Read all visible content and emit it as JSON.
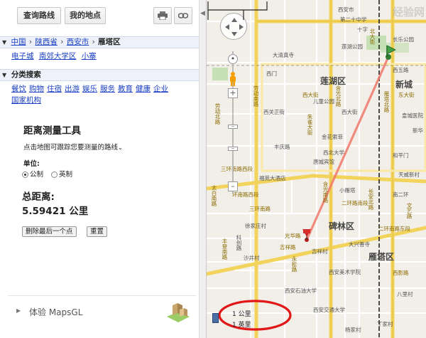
{
  "toolbar": {
    "directions_label": "查询路线",
    "myplaces_label": "我的地点",
    "print_icon": "print-icon",
    "link_icon": "link-icon"
  },
  "breadcrumb": {
    "items": [
      "中国",
      "陕西省",
      "西安市"
    ],
    "current": "雁塔区"
  },
  "sub_areas": [
    "电子城",
    "南郊大学区",
    "小寨"
  ],
  "category": {
    "title": "分类搜索",
    "items": [
      "餐饮",
      "购物",
      "住宿",
      "出游",
      "娱乐",
      "服务",
      "教育",
      "健康",
      "企业",
      "国家机构"
    ]
  },
  "measure_tool": {
    "title": "距离测量工具",
    "hint": "点击地图可跟踪您要测量的路线",
    "unit_label": "单位:",
    "unit_options": [
      "公制",
      "英制"
    ],
    "unit_selected": "公制",
    "total_label": "总距离:",
    "total_value": "5.59421 公里",
    "delete_label": "删除最后一个点",
    "reset_label": "重置"
  },
  "mapsgl": {
    "label": "体验 MapsGL"
  },
  "map": {
    "districts": [
      "莲湖区",
      "新城",
      "碑林区",
      "雁塔区"
    ],
    "place_labels": {
      "p1": "西安市",
      "p2": "第二十中学",
      "p3": "西五路",
      "p4": "儿童公园",
      "p5": "大清真寺",
      "p6": "西大街",
      "p7": "西关正街",
      "p8": "金花索菲",
      "p9": "西北大学",
      "p10": "丰庆路",
      "p11": "唐城宾馆",
      "p12": "福苑大酒店",
      "p13": "小雁塔",
      "p14": "徐家庄村",
      "p15": "科创路",
      "p16": "沙井村",
      "p17": "吉祥村",
      "p18": "大兴善寺",
      "p19": "西安美术学院",
      "p20": "西安石油大学",
      "p21": "西安交通大学",
      "p22": "杨家村",
      "p23": "丁家村",
      "p24": "八里村",
      "p25": "天威新村",
      "p26": "南二环",
      "p27": "二环南路东段",
      "p28": "三环南路西段",
      "p29": "环南路西段",
      "p30": "光华路",
      "p31": "吉祥路",
      "p32": "太白南路",
      "p33": "含光南路",
      "p34": "朱雀大街",
      "p35": "长安北路",
      "p36": "雁塔北路",
      "p37": "西影路",
      "p38": "永松路",
      "p39": "丰登南路",
      "p40": "劳动南路",
      "p41": "西门",
      "p42": "莲湖公园",
      "p43": "长乐公园",
      "p44": "北大街",
      "p45": "东大街",
      "p46": "和平门",
      "p47": "十字",
      "p48": "皇城医院",
      "p49": "文艺路",
      "p50": "新华",
      "p51": "含光北路",
      "p52": "劳动北路",
      "p53": "西大街",
      "p54": "二环路南段",
      "p55": "三环南路"
    },
    "scale": {
      "km_label": "1 公里",
      "mi_label": "1 英里"
    },
    "watermark": "经验网",
    "accent": "#f0786a"
  }
}
